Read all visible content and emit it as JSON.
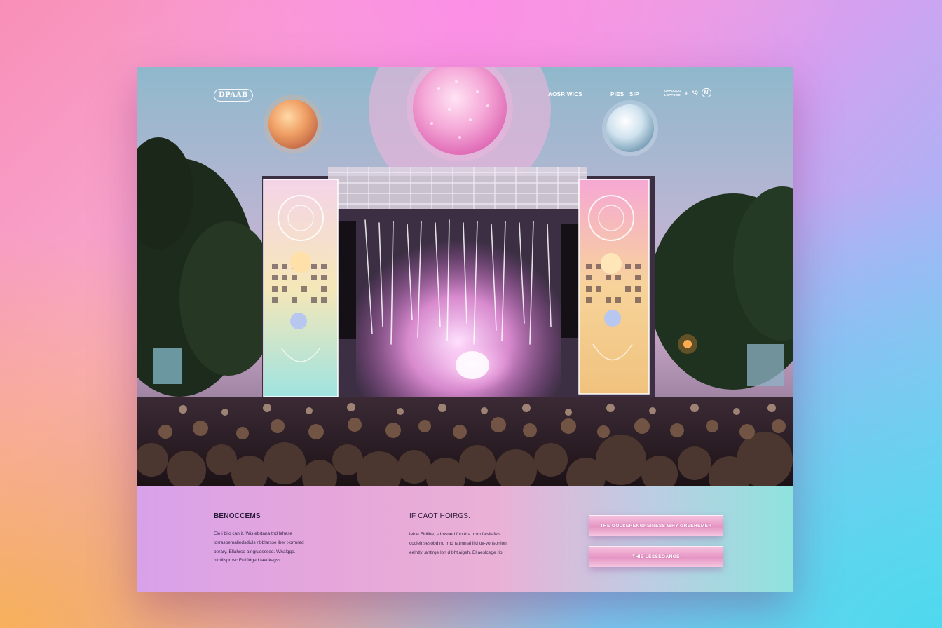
{
  "nav": {
    "logo": "DPAAB",
    "link_1": "AOSR WICS",
    "link_2": "PIES",
    "link_3": "SIP",
    "right_line_1": "OPPOOOO",
    "right_line_2": "LOPPOOO",
    "right_plus": "+",
    "right_small": "AQ",
    "right_pill": "M"
  },
  "footer": {
    "col1_title": "BENOCCEMS",
    "col1_lines": [
      "Ele i bilo can it. Wis ebrtana thd lahese",
      "torrasoemaliedsdiuls ribblarsse iber t-ormred",
      "berary. Ellahrso aingrudsssed. Whalgge.",
      "hithillsprosc Euilfidged tavokagss."
    ],
    "col2_title": "IF CAOT HOIRGS.",
    "col2_lines": [
      "lelde Eldlihe, sdmsnerl fpord,a trom falsliafels",
      "coclelnsesobd no mtd ratrnnlal illd ov-vonsortlon",
      "eelntly .ahtlrge lon d bhtlaigeh. El aeslcege rio"
    ],
    "btn_primary": "THE GOLSERENGREINESS WHY GREEHEMER",
    "btn_secondary": "THIE LESSEOANGE"
  },
  "colors": {
    "accent_pink": "#e695c4",
    "dark_text": "#2a1a3a",
    "teal_edge": "#8ee3dd"
  },
  "icons": [
    "rose-gold-disco-ball-icon",
    "pink-disco-ball-icon",
    "silver-disco-ball-icon"
  ]
}
